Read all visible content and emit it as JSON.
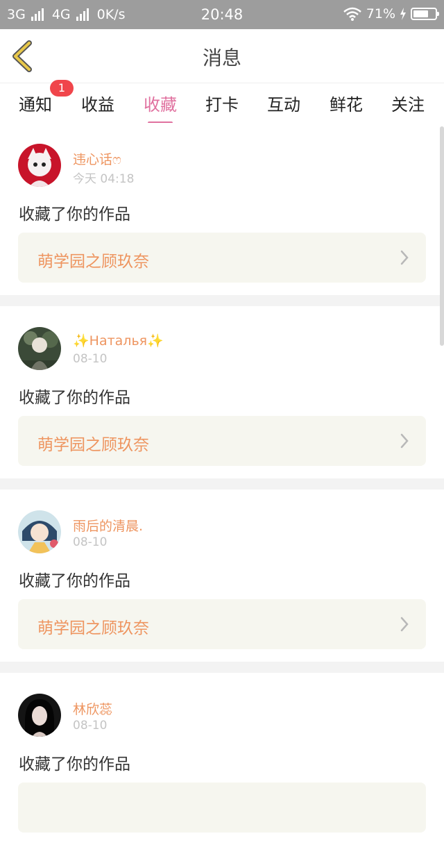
{
  "status_bar": {
    "network1": "3G",
    "network2": "4G",
    "speed": "0K/s",
    "time": "20:48",
    "battery_text": "71%",
    "battery_level": 0.71
  },
  "header": {
    "title": "消息"
  },
  "tabs": [
    {
      "label": "通知",
      "badge": "1"
    },
    {
      "label": "收益"
    },
    {
      "label": "收藏",
      "active": true
    },
    {
      "label": "打卡"
    },
    {
      "label": "互动"
    },
    {
      "label": "鲜花"
    },
    {
      "label": "关注"
    }
  ],
  "messages": [
    {
      "user": "违心话ෆ",
      "time": "今天 04:18",
      "text": "收藏了你的作品",
      "work": "萌学园之顾玖奈"
    },
    {
      "user": "✨Наталья✨",
      "time": "08-10",
      "text": "收藏了你的作品",
      "work": "萌学园之顾玖奈"
    },
    {
      "user": "雨后的清晨.",
      "time": "08-10",
      "text": "收藏了你的作品",
      "work": "萌学园之顾玖奈"
    },
    {
      "user": "林欣蕊",
      "time": "08-10",
      "text": "收藏了你的作品",
      "work": ""
    }
  ],
  "colors": {
    "accent": "#e0719f",
    "username": "#ee9560",
    "card_bg": "#f6f6ef",
    "badge": "#f0454b"
  }
}
